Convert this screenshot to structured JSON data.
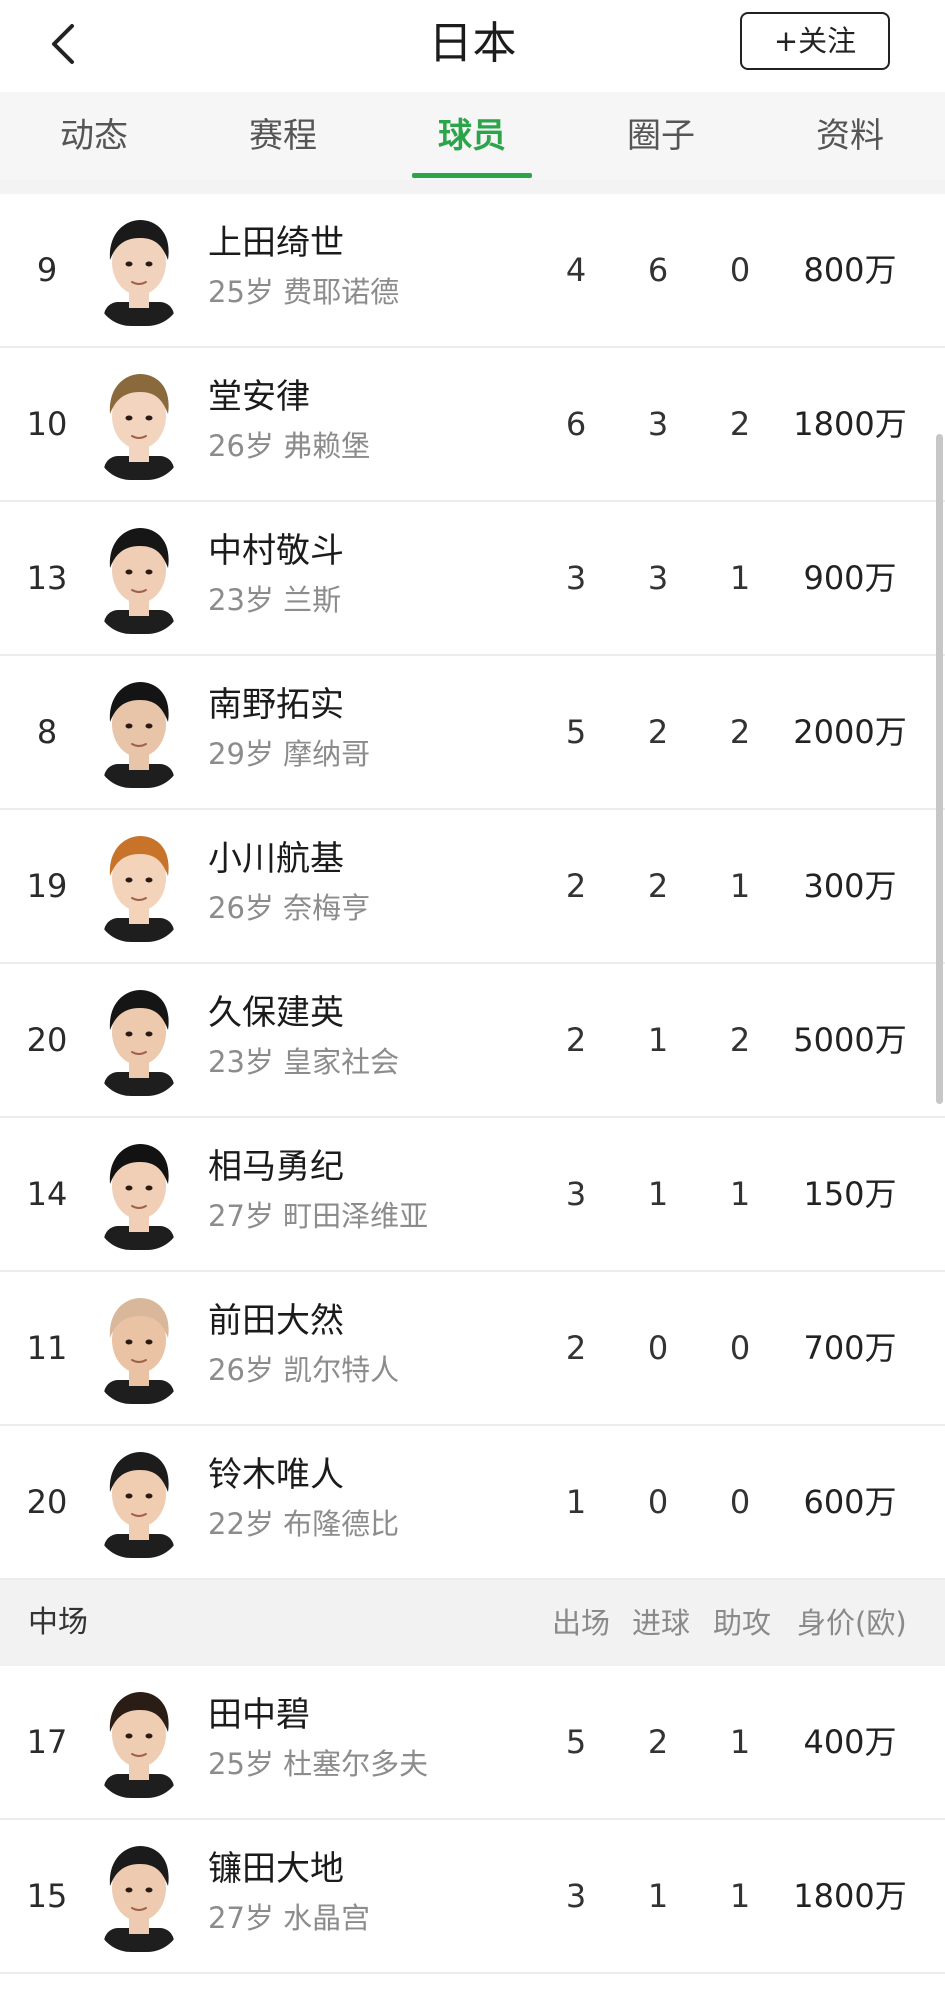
{
  "header": {
    "title": "日本",
    "follow_label": "+关注"
  },
  "tabs": [
    {
      "label": "动态",
      "active": false
    },
    {
      "label": "赛程",
      "active": false
    },
    {
      "label": "球员",
      "active": true
    },
    {
      "label": "圈子",
      "active": false
    },
    {
      "label": "资料",
      "active": false
    }
  ],
  "accent_color": "#2ca44a",
  "players_top": [
    {
      "number": "9",
      "name": "上田绮世",
      "info": "25岁 费耶诺德",
      "apps": "4",
      "goals": "6",
      "assists": "0",
      "value": "800万"
    },
    {
      "number": "10",
      "name": "堂安律",
      "info": "26岁 弗赖堡",
      "apps": "6",
      "goals": "3",
      "assists": "2",
      "value": "1800万"
    },
    {
      "number": "13",
      "name": "中村敬斗",
      "info": "23岁 兰斯",
      "apps": "3",
      "goals": "3",
      "assists": "1",
      "value": "900万"
    },
    {
      "number": "8",
      "name": "南野拓实",
      "info": "29岁 摩纳哥",
      "apps": "5",
      "goals": "2",
      "assists": "2",
      "value": "2000万"
    },
    {
      "number": "19",
      "name": "小川航基",
      "info": "26岁 奈梅亨",
      "apps": "2",
      "goals": "2",
      "assists": "1",
      "value": "300万"
    },
    {
      "number": "20",
      "name": "久保建英",
      "info": "23岁 皇家社会",
      "apps": "2",
      "goals": "1",
      "assists": "2",
      "value": "5000万"
    },
    {
      "number": "14",
      "name": "相马勇纪",
      "info": "27岁 町田泽维亚",
      "apps": "3",
      "goals": "1",
      "assists": "1",
      "value": "150万"
    },
    {
      "number": "11",
      "name": "前田大然",
      "info": "26岁 凯尔特人",
      "apps": "2",
      "goals": "0",
      "assists": "0",
      "value": "700万"
    },
    {
      "number": "20",
      "name": "铃木唯人",
      "info": "22岁 布隆德比",
      "apps": "1",
      "goals": "0",
      "assists": "0",
      "value": "600万"
    }
  ],
  "midfield_section": {
    "label": "中场",
    "columns": [
      "出场",
      "进球",
      "助攻",
      "身价(欧)"
    ]
  },
  "players_mid": [
    {
      "number": "17",
      "name": "田中碧",
      "info": "25岁 杜塞尔多夫",
      "apps": "5",
      "goals": "2",
      "assists": "1",
      "value": "400万"
    },
    {
      "number": "15",
      "name": "镰田大地",
      "info": "27岁 水晶宫",
      "apps": "3",
      "goals": "1",
      "assists": "1",
      "value": "1800万"
    }
  ]
}
